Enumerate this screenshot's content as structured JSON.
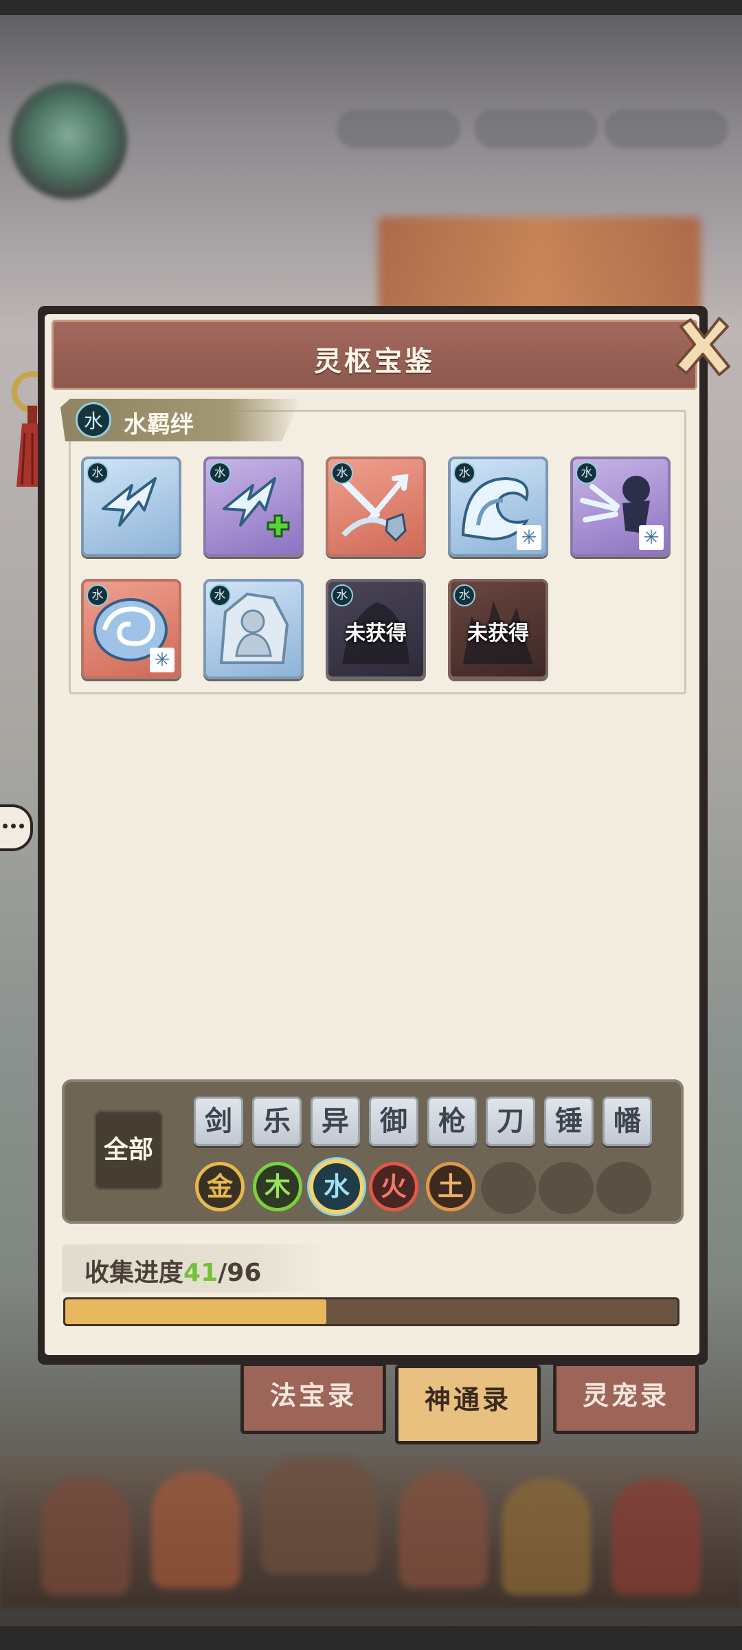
{
  "dialog": {
    "title": "灵枢宝鉴"
  },
  "bond": {
    "element_badge": "水",
    "title": "水羁绊",
    "cards": [
      {
        "badge": "水",
        "style": "blue",
        "art": "lightning-arrow-icon",
        "locked_text": ""
      },
      {
        "badge": "水",
        "style": "purple",
        "art": "lightning-arrow-plus-icon",
        "locked_text": ""
      },
      {
        "badge": "水",
        "style": "red",
        "art": "arrow-shield-icon",
        "locked_text": ""
      },
      {
        "badge": "水",
        "style": "blue",
        "art": "wave-icon",
        "locked_text": ""
      },
      {
        "badge": "水",
        "style": "purple",
        "art": "ice-burst-icon",
        "locked_text": ""
      },
      {
        "badge": "水",
        "style": "red",
        "art": "whirlpool-icon",
        "locked_text": ""
      },
      {
        "badge": "水",
        "style": "blue",
        "art": "ice-figure-icon",
        "locked_text": ""
      },
      {
        "badge": "水",
        "style": "dark",
        "art": "locked-rock-icon",
        "locked_text": "未获得"
      },
      {
        "badge": "水",
        "style": "dark-red",
        "art": "locked-crystal-icon",
        "locked_text": "未获得"
      }
    ]
  },
  "filters": {
    "all_label": "全部",
    "weapon_types": [
      "剑",
      "乐",
      "异",
      "御",
      "枪",
      "刀",
      "锤",
      "幡"
    ],
    "elements": [
      {
        "label": "金",
        "color": "#e5b94a",
        "selected": false
      },
      {
        "label": "木",
        "color": "#7ccf3f",
        "selected": false
      },
      {
        "label": "水",
        "color": "#8fd0e3",
        "selected": true
      },
      {
        "label": "火",
        "color": "#e0584a",
        "selected": false
      },
      {
        "label": "土",
        "color": "#d99a4a",
        "selected": false
      }
    ]
  },
  "progress": {
    "label": "收集进度",
    "current": "41",
    "total": "/96",
    "fraction": 0.427
  },
  "tabs": [
    {
      "label": "法宝录",
      "active": false
    },
    {
      "label": "神通录",
      "active": true
    },
    {
      "label": "灵宠录",
      "active": false
    }
  ],
  "colors": {
    "panel_bg": "#f3ece1",
    "header_bg": "#8c574d",
    "progress_fill": "#e7b85e",
    "progress_highlight": "#71c13a"
  }
}
